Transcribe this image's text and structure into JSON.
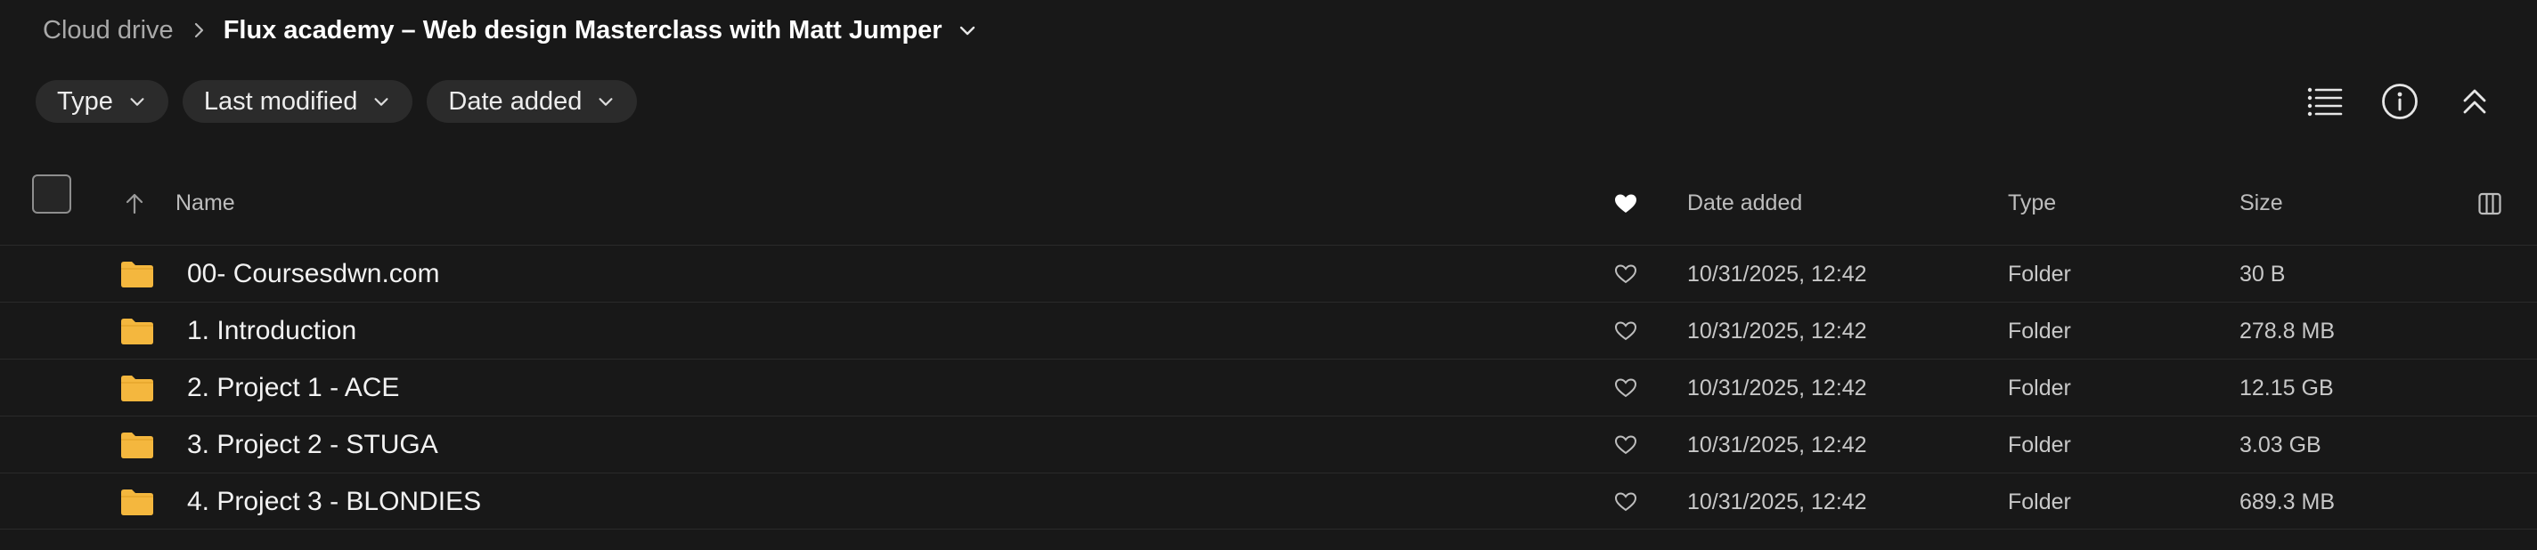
{
  "breadcrumb": {
    "root": "Cloud drive",
    "current": "Flux academy – Web design Masterclass with Matt Jumper"
  },
  "filters": [
    {
      "label": "Type"
    },
    {
      "label": "Last modified"
    },
    {
      "label": "Date added"
    }
  ],
  "tools": [
    "list-view-icon",
    "info-icon",
    "collapse-icon"
  ],
  "table": {
    "columns": {
      "name": "Name",
      "date_added": "Date added",
      "type": "Type",
      "size": "Size"
    },
    "rows": [
      {
        "name": "00- Coursesdwn.com",
        "date_added": "10/31/2025, 12:42",
        "type": "Folder",
        "size": "30 B"
      },
      {
        "name": "1. Introduction",
        "date_added": "10/31/2025, 12:42",
        "type": "Folder",
        "size": "278.8 MB"
      },
      {
        "name": "2. Project 1 - ACE",
        "date_added": "10/31/2025, 12:42",
        "type": "Folder",
        "size": "12.15 GB"
      },
      {
        "name": "3. Project 2 - STUGA",
        "date_added": "10/31/2025, 12:42",
        "type": "Folder",
        "size": "3.03 GB"
      },
      {
        "name": "4. Project 3 - BLONDIES",
        "date_added": "10/31/2025, 12:42",
        "type": "Folder",
        "size": "689.3 MB"
      }
    ]
  },
  "colors": {
    "background": "#181818",
    "chip": "#2b2b2b",
    "folder": "#f4b73e"
  }
}
